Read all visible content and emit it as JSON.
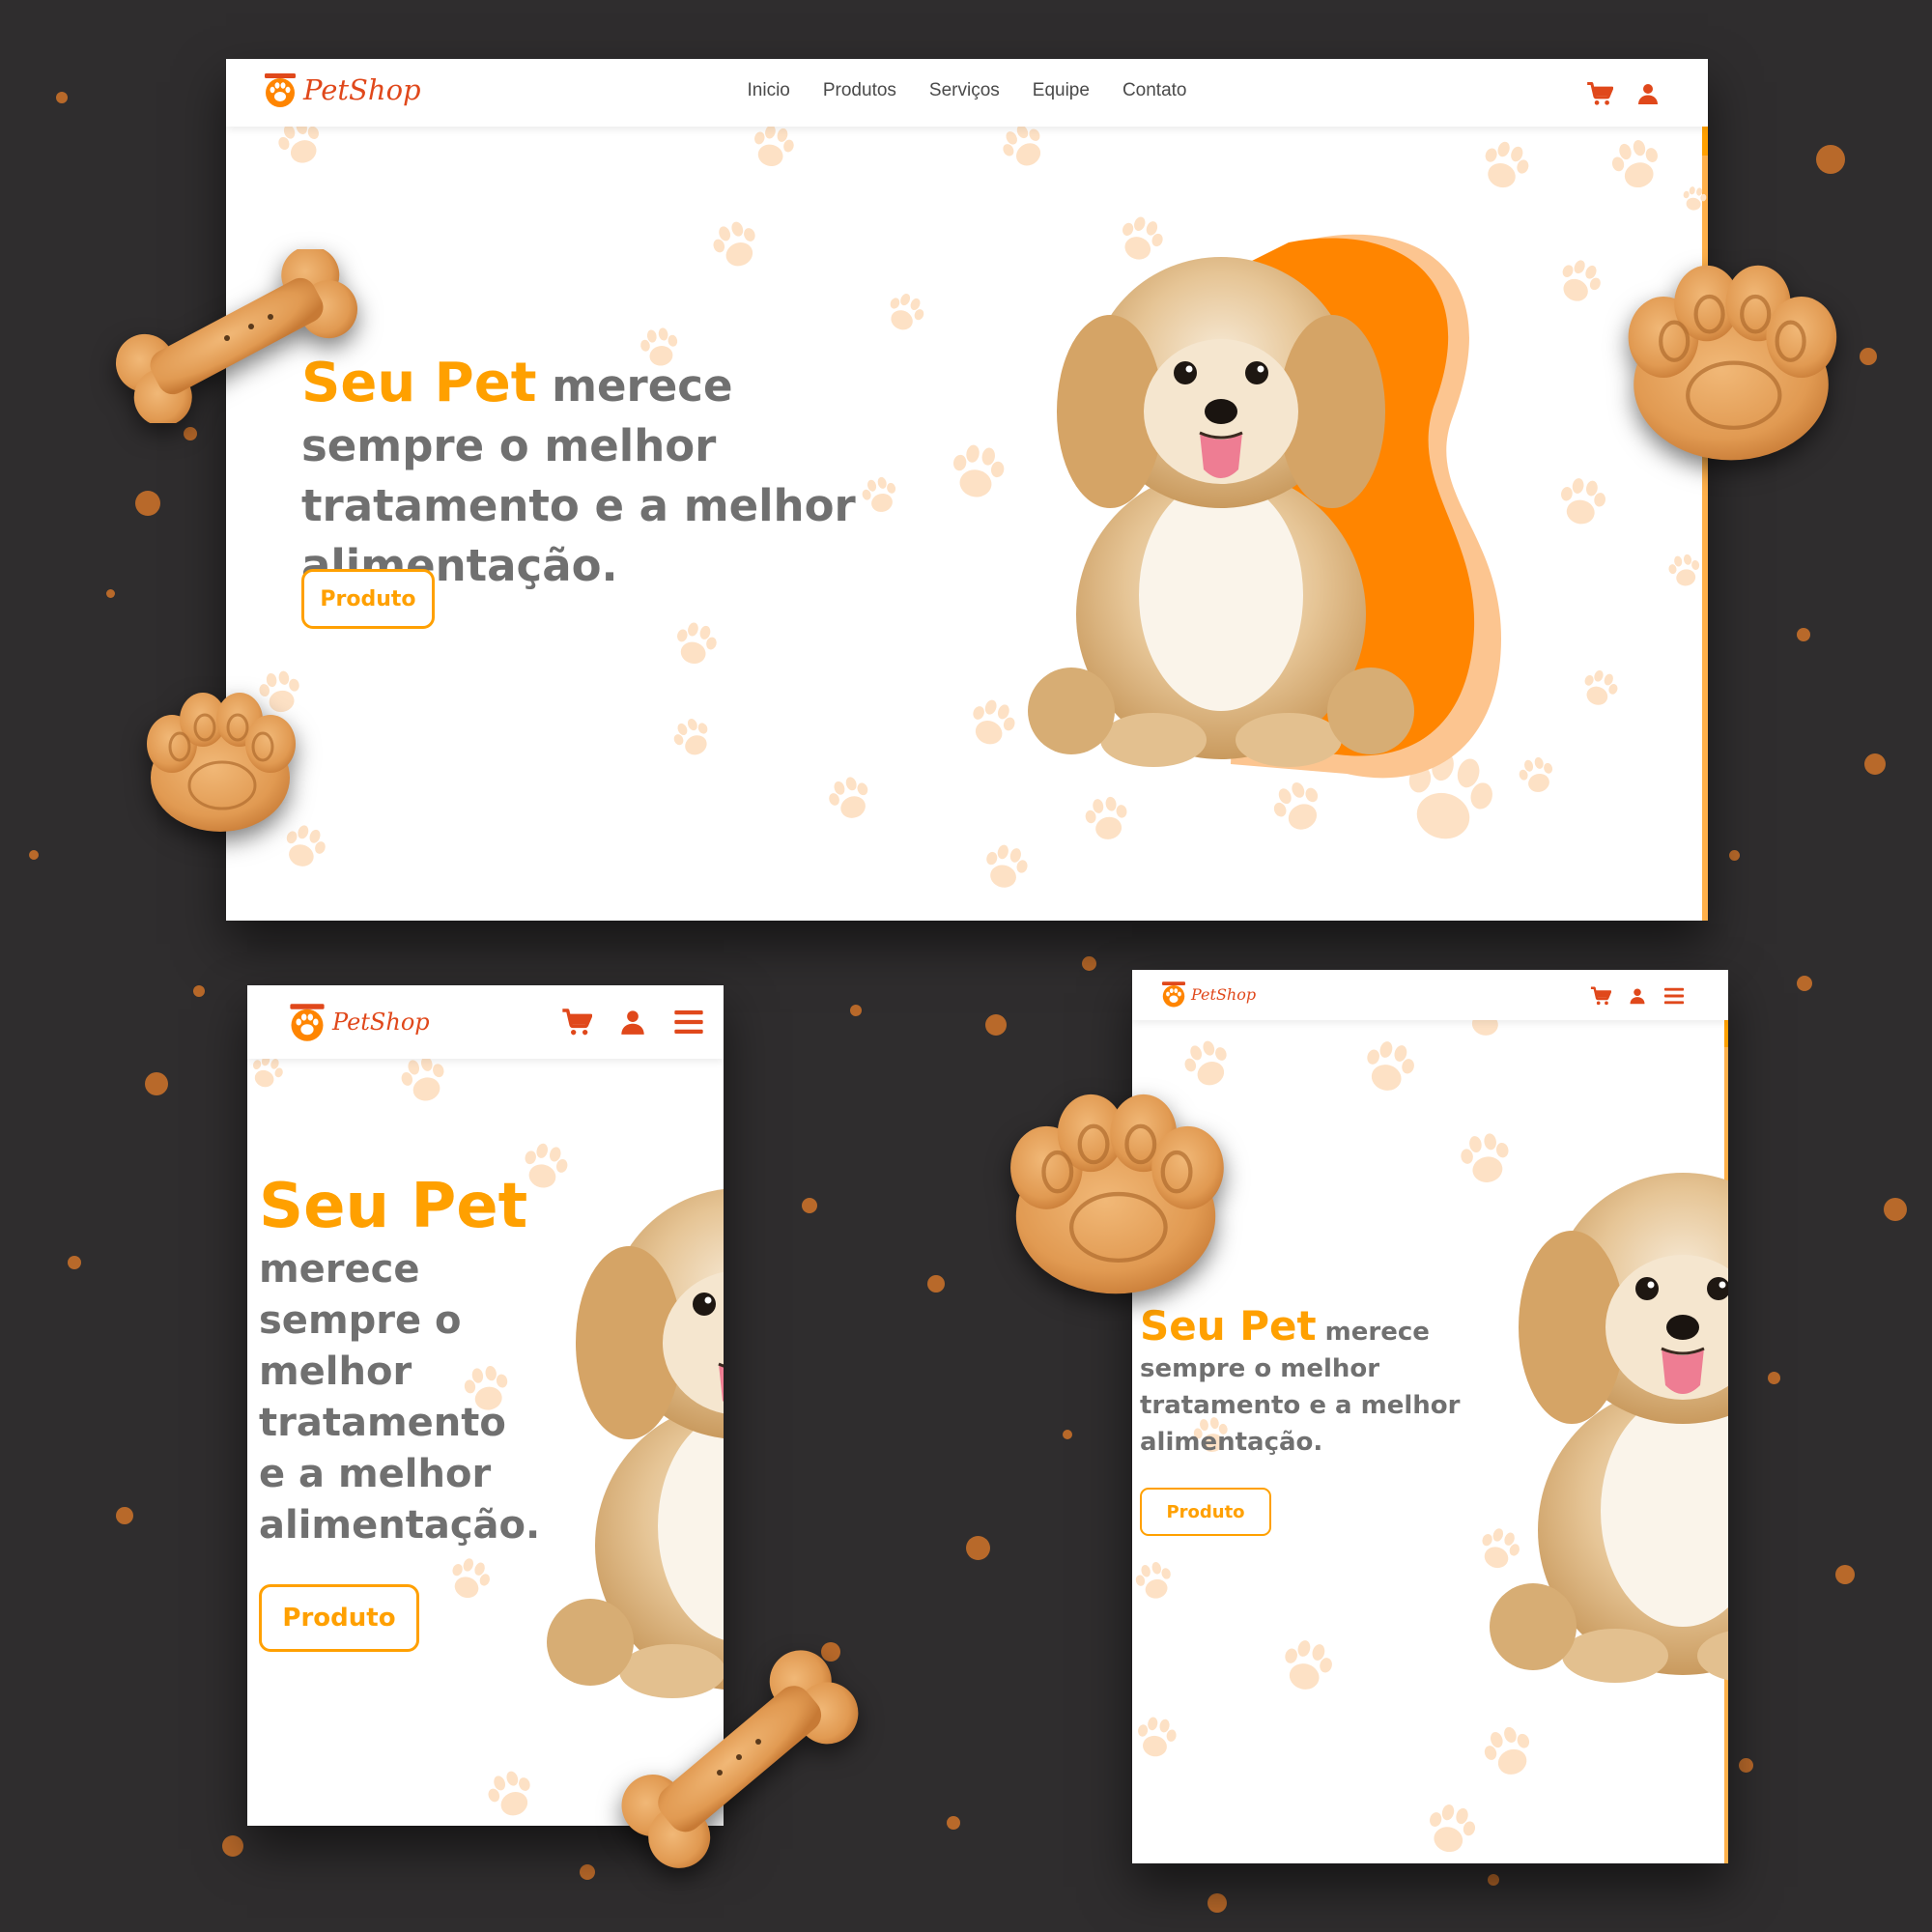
{
  "colors": {
    "background": "#2f2d2e",
    "accent": "#ffa000",
    "brand": "#e0481b",
    "blob": "#ff8500",
    "paw": "#fde1c5",
    "text": "#707070"
  },
  "brand": {
    "name": "PetShop"
  },
  "nav": {
    "items": [
      {
        "label": "Inicio"
      },
      {
        "label": "Produtos"
      },
      {
        "label": "Serviços"
      },
      {
        "label": "Equipe"
      },
      {
        "label": "Contato"
      }
    ]
  },
  "icons": {
    "cart": "cart-icon",
    "user": "user-icon",
    "menu": "hamburger-menu-icon",
    "logo": "paw-logo-icon",
    "decor": "paw-print-icon"
  },
  "hero": {
    "highlight": "Seu Pet",
    "rest": "merece sempre o melhor tratamento e a melhor alimentação.",
    "mobile_rest_lines": [
      "merece",
      "sempre o",
      "melhor",
      "tratamento",
      "e a melhor",
      "alimentação."
    ],
    "tablet_first_line_rest": "merece",
    "tablet_lines": [
      "sempre o melhor",
      "tratamento e a melhor",
      "alimentação."
    ],
    "button_label": "Produto"
  }
}
